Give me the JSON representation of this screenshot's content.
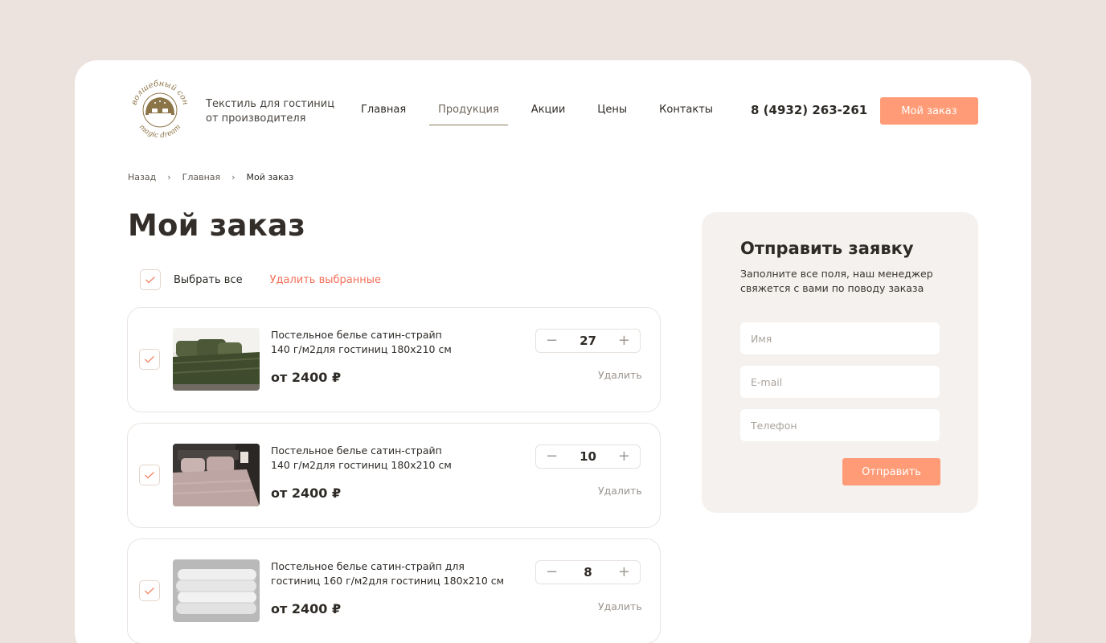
{
  "header": {
    "logo_text_top": "волшебный сон",
    "logo_text_bottom": "magic dream",
    "tagline_line1": "Текстиль для гостиниц",
    "tagline_line2": "от производителя",
    "nav": [
      {
        "label": "Главная",
        "active": false
      },
      {
        "label": "Продукция",
        "active": true
      },
      {
        "label": "Акции",
        "active": false
      },
      {
        "label": "Цены",
        "active": false
      },
      {
        "label": "Контакты",
        "active": false
      }
    ],
    "phone": "8 (4932) 263-261",
    "order_button": "Мой заказ"
  },
  "breadcrumb": {
    "items": [
      "Назад",
      "Главная",
      "Мой заказ"
    ],
    "separator": "›"
  },
  "page_title": "Мой заказ",
  "selection": {
    "select_all_label": "Выбрать все",
    "select_all_checked": true,
    "delete_selected_label": "Удалить выбранные"
  },
  "items": [
    {
      "name_line1": "Постельное белье сатин-страйп",
      "name_line2": "140 г/м2для гостиниц  180х210 см",
      "price": "от 2400 ₽",
      "quantity": "27",
      "delete_label": "Удалить",
      "checked": true,
      "image": "green-bedding-photo"
    },
    {
      "name_line1": "Постельное белье сатин-страйп",
      "name_line2": "140 г/м2для гостиниц  180х210 см",
      "price": "от 2400 ₽",
      "quantity": "10",
      "delete_label": "Удалить",
      "checked": true,
      "image": "pink-bedding-photo"
    },
    {
      "name_line1": "Постельное белье сатин-страйп для",
      "name_line2": "гостиниц 160 г/м2для гостиниц  180х210 см",
      "price": "от 2400 ₽",
      "quantity": "8",
      "delete_label": "Удалить",
      "checked": true,
      "image": "white-duvet-photo"
    }
  ],
  "request_form": {
    "title": "Отправить заявку",
    "subtitle": "Заполните все поля, наш менеджер свяжется с вами по поводу заказа",
    "name_placeholder": "Имя",
    "email_placeholder": "E-mail",
    "phone_placeholder": "Телефон",
    "submit_label": "Отправить"
  },
  "colors": {
    "page_background": "#ece2de",
    "accent": "#ff9b76",
    "danger_link": "#f4705a",
    "panel_background": "#f4f1ee",
    "logo_brown": "#8b7447"
  }
}
